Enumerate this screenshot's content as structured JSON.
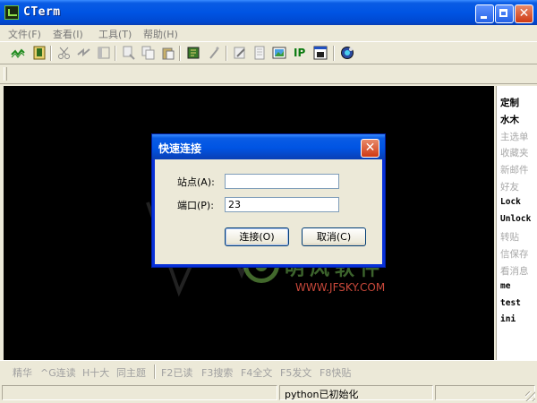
{
  "window": {
    "title": "CTerm"
  },
  "menu": [
    {
      "label": "文件(F)"
    },
    {
      "label": "查看(I)"
    },
    {
      "label": "工具(T)"
    },
    {
      "label": "帮助(H)"
    }
  ],
  "toolbar": {
    "ip_label": "IP"
  },
  "right_panel": [
    {
      "label": "定制",
      "state": "active"
    },
    {
      "label": "水木",
      "state": "active"
    },
    {
      "label": "主选单",
      "state": "dim"
    },
    {
      "label": "收藏夹",
      "state": "dim"
    },
    {
      "label": "新邮件",
      "state": "dim"
    },
    {
      "label": "好友",
      "state": "dim"
    },
    {
      "label": "Lock",
      "state": "active"
    },
    {
      "label": "Unlock",
      "state": "active"
    },
    {
      "label": "转贴",
      "state": "dim"
    },
    {
      "label": "信保存",
      "state": "dim"
    },
    {
      "label": "看消息",
      "state": "dim"
    },
    {
      "label": "me",
      "state": "active"
    },
    {
      "label": "test",
      "state": "active"
    },
    {
      "label": "ini",
      "state": "active"
    }
  ],
  "function_bar": [
    {
      "label": "精华"
    },
    {
      "label": "^G连读"
    },
    {
      "label": "H十大"
    },
    {
      "label": "同主题"
    },
    {
      "label": "F2已读"
    },
    {
      "label": "F3搜索"
    },
    {
      "label": "F4全文"
    },
    {
      "label": "F5发文"
    },
    {
      "label": "F8快贴"
    }
  ],
  "status": {
    "message": "python已初始化"
  },
  "watermark": {
    "cn": "明风软件",
    "url": "WWW.JFSKY.COM"
  },
  "dialog": {
    "title": "快速连接",
    "site_label": "站点(A):",
    "site_value": "",
    "port_label": "端口(P):",
    "port_value": "23",
    "connect_label": "连接(O)",
    "cancel_label": "取消(C)"
  },
  "colors": {
    "titlebar": "#0054e3",
    "terminal_bg": "#000000",
    "accent_green": "#0a7a10",
    "watermark_url": "#c8483a"
  }
}
